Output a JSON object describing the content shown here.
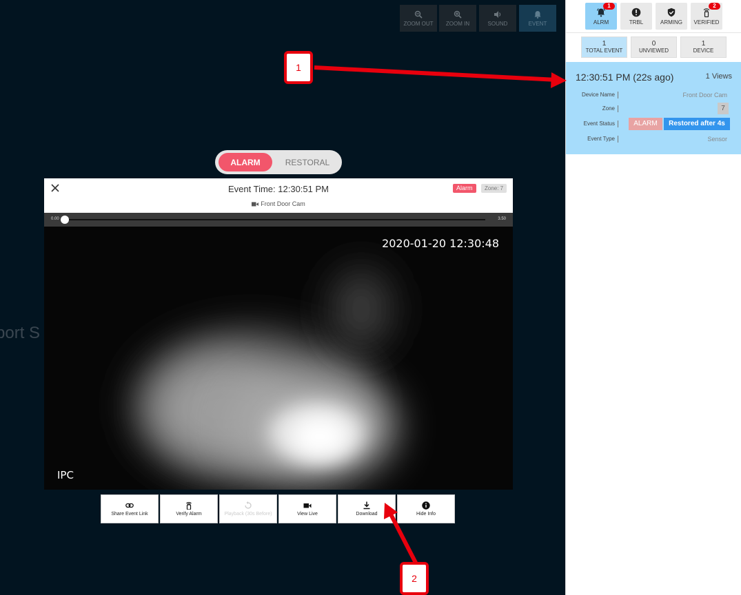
{
  "toolbar": {
    "zoom_out": "ZOOM OUT",
    "zoom_in": "ZOOM IN",
    "sound": "SOUND",
    "event": "EVENT"
  },
  "background_text": "port S",
  "toggle": {
    "alarm": "ALARM",
    "restoral": "RESTORAL"
  },
  "dialog": {
    "event_time": "Event Time: 12:30:51 PM",
    "device": "Front Door Cam",
    "alarm_badge": "Alarm",
    "zone_badge": "Zone: 7"
  },
  "player": {
    "start": "0.00",
    "end": "3.50",
    "progress": 0.0,
    "timestamp": "2020-01-20 12:30:48",
    "watermark": "IPC"
  },
  "actions": [
    {
      "label": "Share Event Link",
      "icon": "link-icon"
    },
    {
      "label": "Verify Alarm",
      "icon": "verify-icon"
    },
    {
      "label": "Playback (30s Before)",
      "icon": "replay-icon",
      "disabled": true
    },
    {
      "label": "View Live",
      "icon": "video-camera-icon"
    },
    {
      "label": "Download",
      "icon": "download-icon"
    },
    {
      "label": "Hide Info",
      "icon": "info-icon"
    }
  ],
  "callouts": {
    "one": "1",
    "two": "2"
  },
  "panel": {
    "tabs": [
      {
        "label": "ALRM",
        "icon": "alarm-bell-icon",
        "badge": "1"
      },
      {
        "label": "TRBL",
        "icon": "trouble-icon"
      },
      {
        "label": "ARMING",
        "icon": "shield-icon"
      },
      {
        "label": "VERIFIED",
        "icon": "verify-icon",
        "badge": "2"
      }
    ],
    "stats": [
      {
        "value": "1",
        "label": "TOTAL EVENT"
      },
      {
        "value": "0",
        "label": "UNVIEWED"
      },
      {
        "value": "1",
        "label": "DEVICE"
      }
    ],
    "card": {
      "time": "12:30:51 PM (22s ago)",
      "views": "1 Views",
      "device_name_label": "Device Name",
      "device_name": "Front Door Cam",
      "zone_label": "Zone",
      "zone": "7",
      "status_label": "Event Status",
      "status_alarm": "ALARM",
      "status_restored": "Restored after 4s",
      "type_label": "Event Type",
      "type": "Sensor"
    }
  },
  "colors": {
    "stage_bg": "#021420",
    "alarm_red": "#f2566b",
    "panel_active": "#8fd0f7",
    "card_bg": "#a6dcfb",
    "restored_blue": "#3395ed",
    "callout_red": "#e8000d"
  }
}
